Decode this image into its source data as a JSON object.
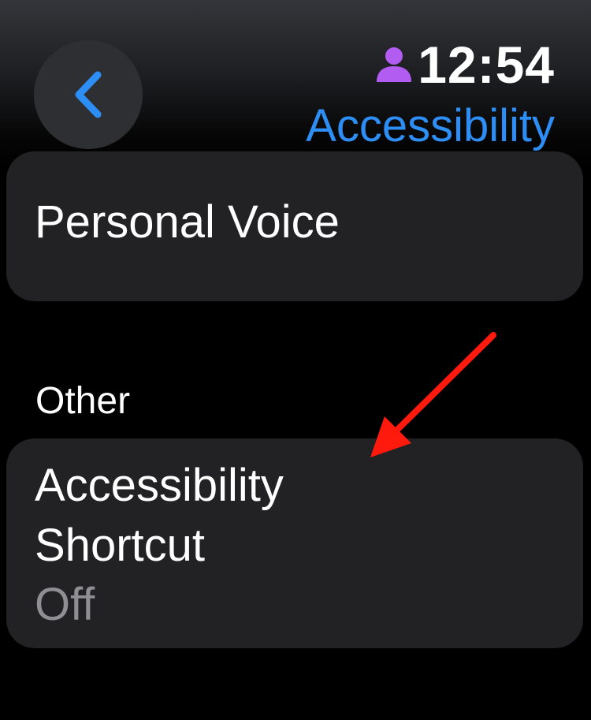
{
  "status": {
    "time": "12:54",
    "person_icon": "person-icon",
    "person_icon_color": "#b35cf1"
  },
  "header": {
    "back_icon": "chevron-left-icon",
    "title": "Accessibility",
    "accent_color": "#2d8ef5"
  },
  "items": {
    "personal_voice": {
      "label": "Personal Voice"
    },
    "section_other": "Other",
    "accessibility_shortcut": {
      "label_line1": "Accessibility",
      "label_line2": "Shortcut",
      "value": "Off"
    }
  },
  "annotation": {
    "arrow_color": "#ff1a0d"
  }
}
